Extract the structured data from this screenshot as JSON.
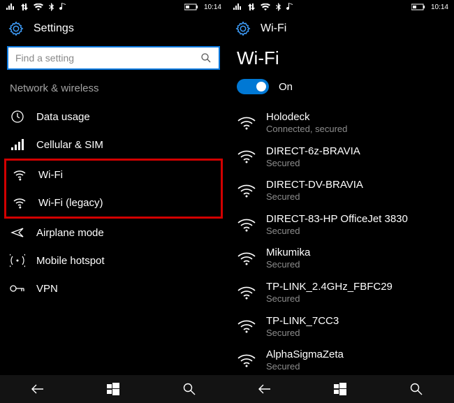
{
  "status": {
    "time": "10:14"
  },
  "left": {
    "title": "Settings",
    "search_placeholder": "Find a setting",
    "section": "Network & wireless",
    "items": [
      {
        "label": "Data usage",
        "icon": "clock-icon"
      },
      {
        "label": "Cellular & SIM",
        "icon": "signal-bars-icon"
      },
      {
        "label": "Wi-Fi",
        "icon": "wifi-icon"
      },
      {
        "label": "Wi-Fi (legacy)",
        "icon": "wifi-icon"
      },
      {
        "label": "Airplane mode",
        "icon": "airplane-icon"
      },
      {
        "label": "Mobile hotspot",
        "icon": "hotspot-icon"
      },
      {
        "label": "VPN",
        "icon": "vpn-icon"
      }
    ]
  },
  "right": {
    "title": "Wi-Fi",
    "heading": "Wi-Fi",
    "toggle_state": "On",
    "networks": [
      {
        "name": "Holodeck",
        "status": "Connected, secured"
      },
      {
        "name": "DIRECT-6z-BRAVIA",
        "status": "Secured"
      },
      {
        "name": "DIRECT-DV-BRAVIA",
        "status": "Secured"
      },
      {
        "name": "DIRECT-83-HP OfficeJet 3830",
        "status": "Secured"
      },
      {
        "name": "Mikumika",
        "status": "Secured"
      },
      {
        "name": "TP-LINK_2.4GHz_FBFC29",
        "status": "Secured"
      },
      {
        "name": "TP-LINK_7CC3",
        "status": "Secured"
      },
      {
        "name": "AlphaSigmaZeta",
        "status": "Secured"
      }
    ]
  }
}
